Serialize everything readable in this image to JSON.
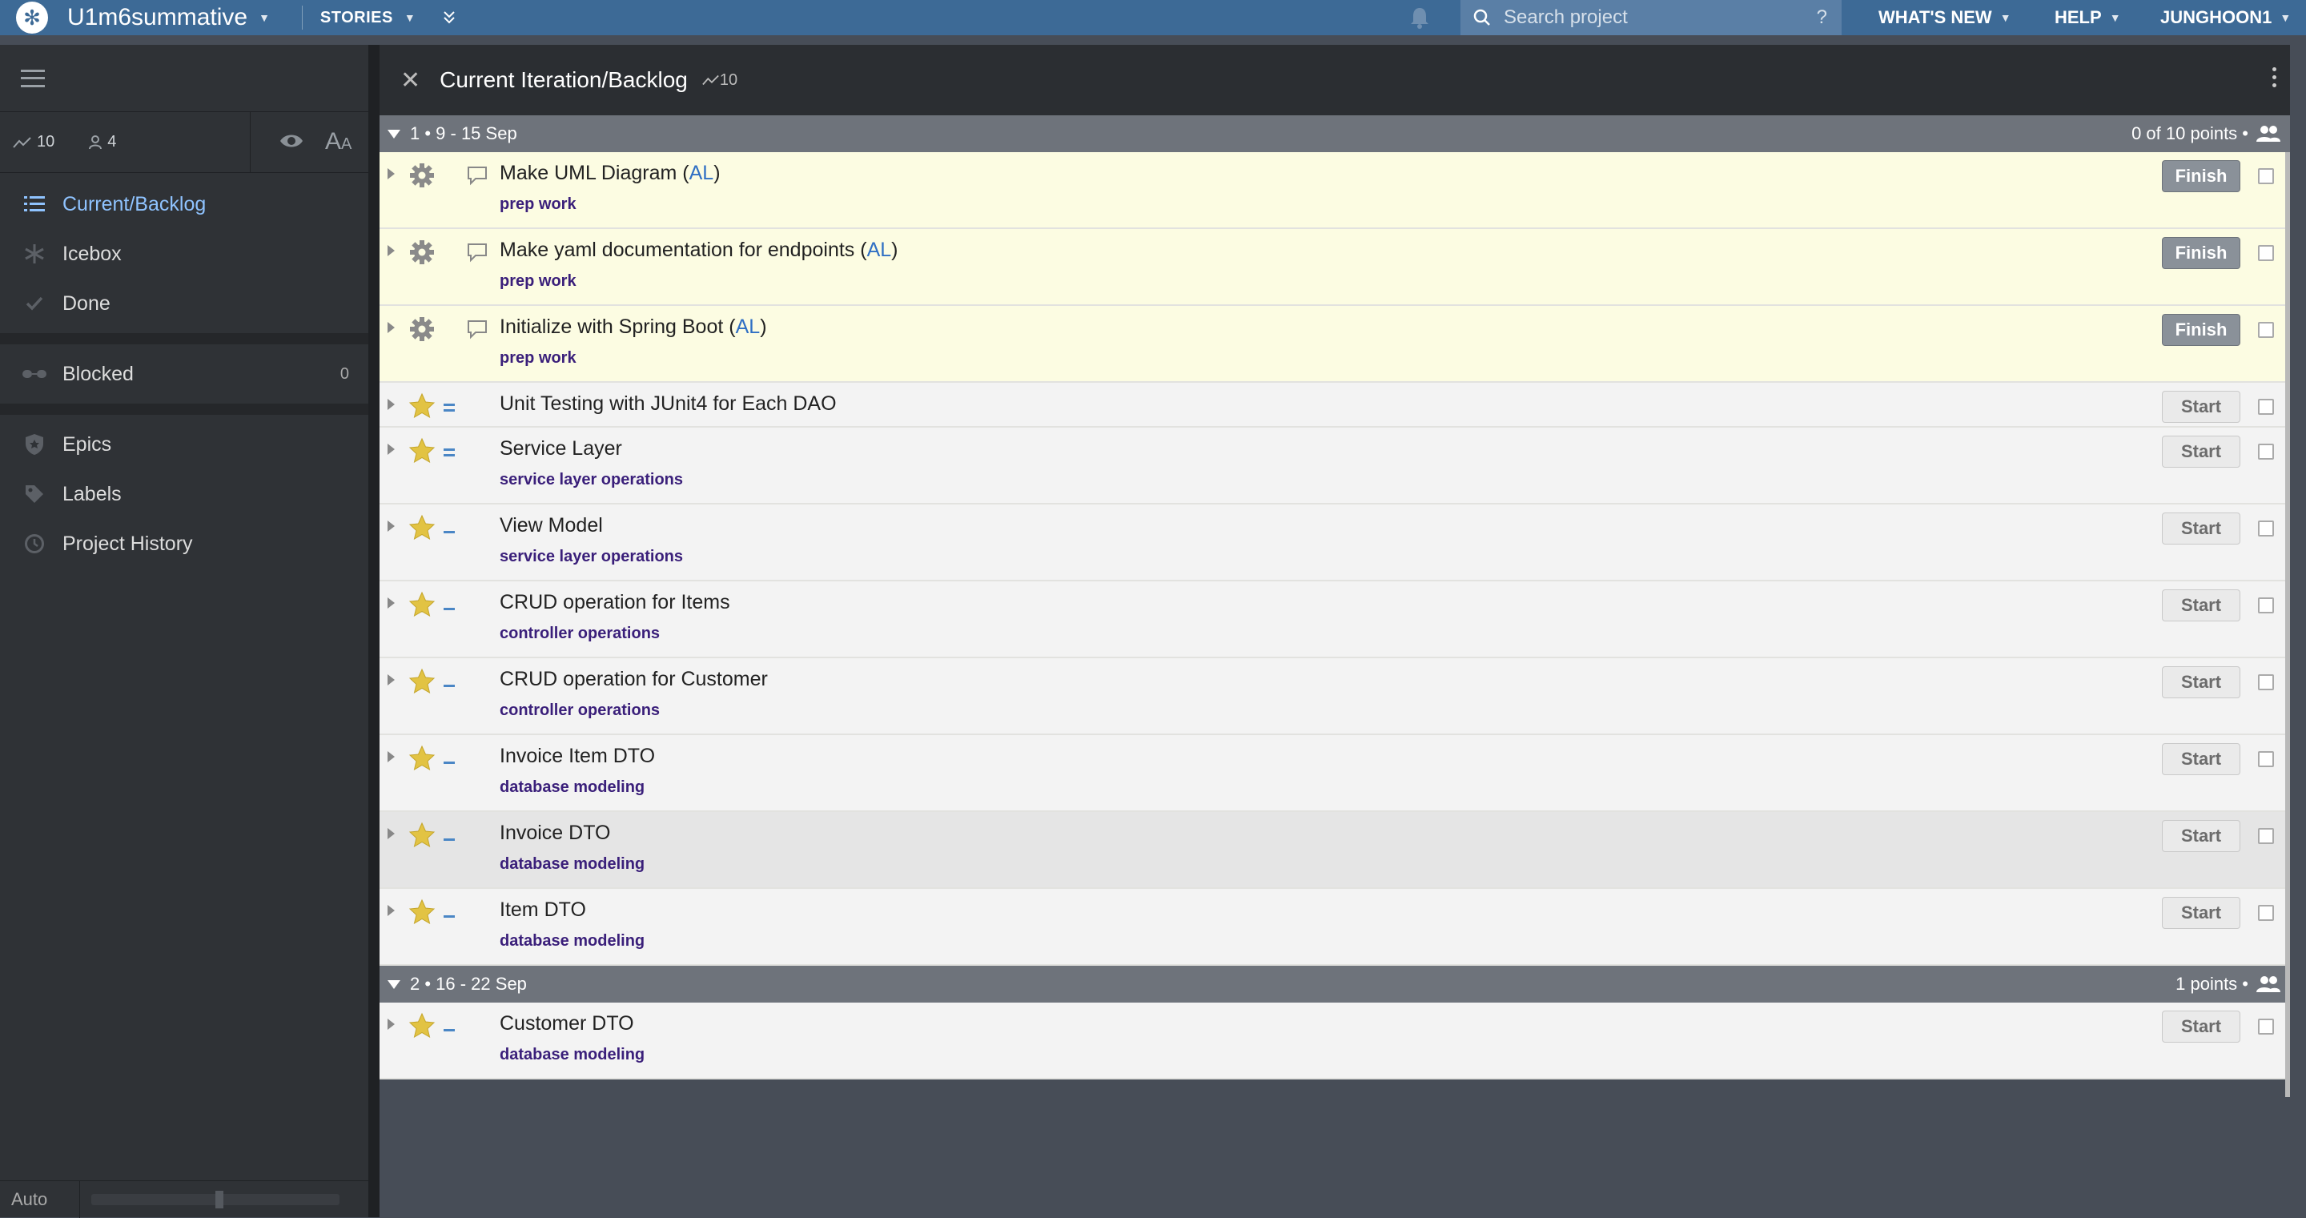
{
  "topbar": {
    "project_name": "U1m6summative",
    "stories_label": "STORIES",
    "search_placeholder": "Search project",
    "search_help": "?",
    "whats_new": "WHAT'S NEW",
    "help": "HELP",
    "user": "JUNGHOON1"
  },
  "sidebar": {
    "velocity": "10",
    "members": "4",
    "aa_big": "A",
    "aa_small": "A",
    "nav": [
      {
        "label": "Current/Backlog",
        "icon": "list-icon"
      },
      {
        "label": "Icebox",
        "icon": "snowflake-icon"
      },
      {
        "label": "Done",
        "icon": "check-icon"
      },
      {
        "label": "Blocked",
        "icon": "blocked-icon",
        "count": "0"
      },
      {
        "label": "Epics",
        "icon": "shield-icon"
      },
      {
        "label": "Labels",
        "icon": "tag-icon"
      },
      {
        "label": "Project History",
        "icon": "clock-icon"
      }
    ],
    "footer_auto": "Auto"
  },
  "panel": {
    "title": "Current Iteration/Backlog",
    "points": "10"
  },
  "iterations": [
    {
      "label": "1 • 9 - 15 Sep",
      "points_label": "0 of 10 points •"
    },
    {
      "label": "2 • 16 - 22 Sep",
      "points_label": "1 points •"
    }
  ],
  "stories": [
    {
      "title": "Make UML Diagram (",
      "owner": "AL",
      "suffix": ")",
      "label": "prep work",
      "button": "Finish",
      "type": "chore"
    },
    {
      "title": "Make yaml documentation for endpoints (",
      "owner": "AL",
      "suffix": ")",
      "label": "prep work",
      "button": "Finish",
      "type": "chore"
    },
    {
      "title": "Initialize with Spring Boot (",
      "owner": "AL",
      "suffix": ")",
      "label": "prep work",
      "button": "Finish",
      "type": "chore"
    },
    {
      "title": "Unit Testing with JUnit4 for Each DAO",
      "label": "",
      "button": "Start",
      "type": "feature"
    },
    {
      "title": "Service Layer",
      "label": "service layer operations",
      "button": "Start",
      "type": "feature"
    },
    {
      "title": "View Model",
      "label": "service layer operations",
      "button": "Start",
      "type": "feature"
    },
    {
      "title": "CRUD operation for Items",
      "label": "controller operations",
      "button": "Start",
      "type": "feature"
    },
    {
      "title": "CRUD operation for Customer",
      "label": "controller operations",
      "button": "Start",
      "type": "feature"
    },
    {
      "title": "Invoice Item DTO",
      "label": "database modeling",
      "button": "Start",
      "type": "feature"
    },
    {
      "title": "Invoice DTO",
      "label": "database modeling",
      "button": "Start",
      "type": "feature"
    },
    {
      "title": "Item DTO",
      "label": "database modeling",
      "button": "Start",
      "type": "feature"
    },
    {
      "title": "Customer DTO",
      "label": "database modeling",
      "button": "Start",
      "type": "feature"
    }
  ],
  "colors": {
    "topbar": "#3d6a96",
    "chore_bg": "#fcfce2",
    "label_text": "#3a1f7a",
    "owner_link": "#2f6fc4",
    "active_nav": "#8fc3ff"
  }
}
